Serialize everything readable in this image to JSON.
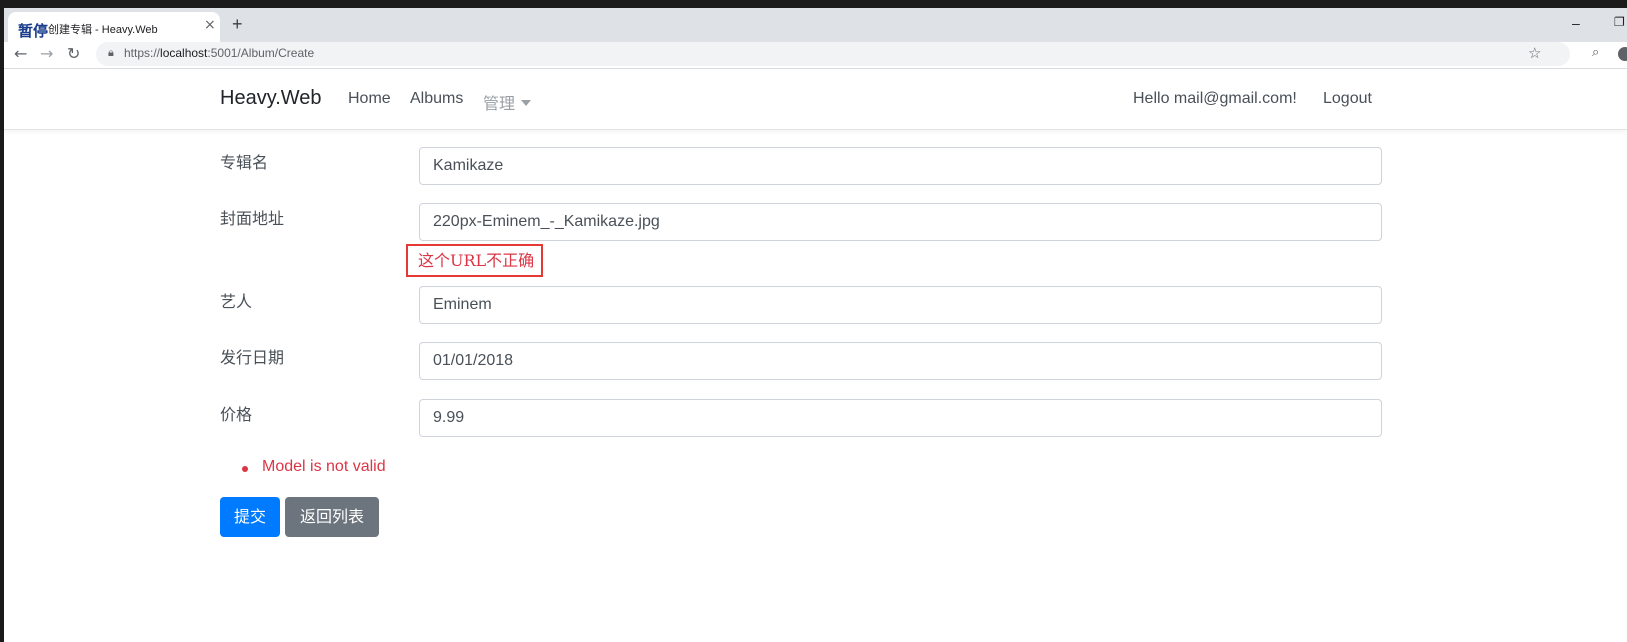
{
  "browser": {
    "tab_overlay_text": "暂停",
    "tab_title": "创建专辑 - Heavy.Web",
    "close_glyph": "×",
    "new_tab_glyph": "+",
    "url_prefix": "https://",
    "url_host": "localhost",
    "url_rest": ":5001/Album/Create",
    "window_min_glyph": "–",
    "window_max_glyph": "❐"
  },
  "navbar": {
    "brand": "Heavy.Web",
    "links": [
      "Home",
      "Albums",
      "管理"
    ],
    "greeting": "Hello mail@gmail.com!",
    "logout": "Logout"
  },
  "form": {
    "fields": [
      {
        "label": "专辑名",
        "value": "Kamikaze"
      },
      {
        "label": "封面地址",
        "value": "220px-Eminem_-_Kamikaze.jpg"
      },
      {
        "label": "艺人",
        "value": "Eminem"
      },
      {
        "label": "发行日期",
        "value": "01/01/2018"
      },
      {
        "label": "价格",
        "value": "9.99"
      }
    ],
    "cover_error": "这个URL不正确",
    "validation_summary": "Model is not valid",
    "submit_label": "提交",
    "back_label": "返回列表"
  },
  "colors": {
    "primary": "#007bff",
    "secondary": "#6c757d",
    "danger": "#dc3545",
    "highlight_box": "#e53935"
  }
}
